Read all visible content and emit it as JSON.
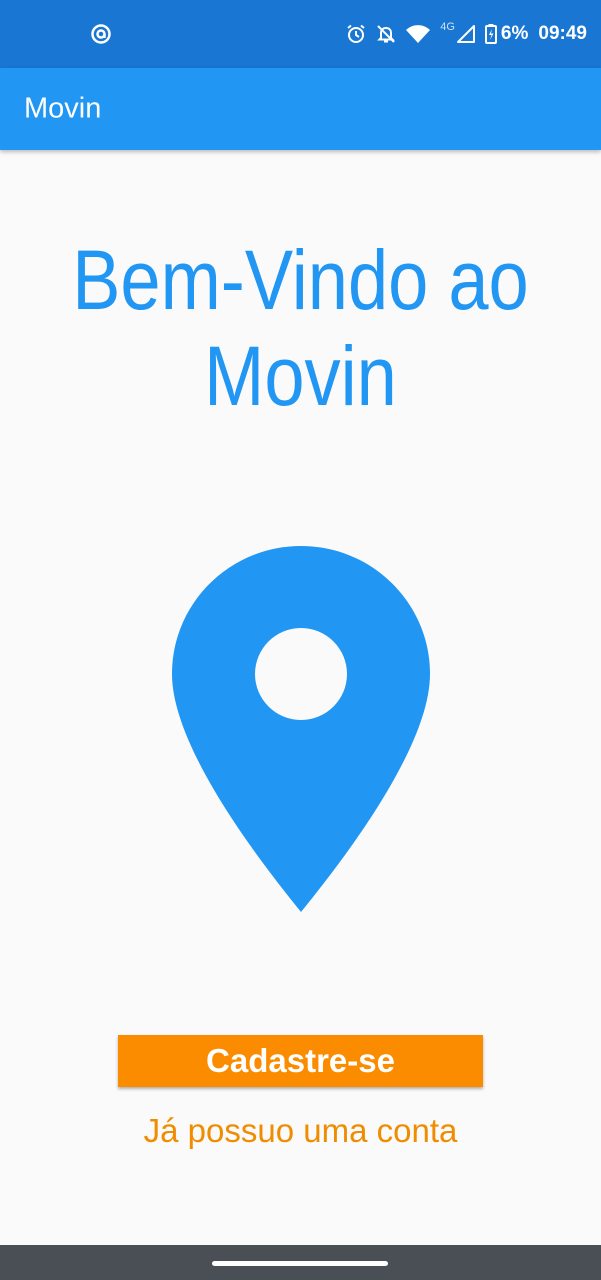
{
  "status_bar": {
    "left_icon": "at-sign-icon",
    "icons": [
      "alarm-icon",
      "notifications-off-icon",
      "wifi-icon",
      "cell-signal-icon",
      "battery-charging-icon"
    ],
    "network_label": "4G",
    "battery": "6%",
    "time": "09:49",
    "background": "#1976d2"
  },
  "app_bar": {
    "title": "Movin",
    "background": "#2196f3"
  },
  "main": {
    "welcome_line1": "Bem-Vindo ao",
    "welcome_line2": "Movin",
    "welcome_color": "#2196f3",
    "pin_icon": "location-pin-icon",
    "pin_color": "#2196f3"
  },
  "actions": {
    "signup_label": "Cadastre-se",
    "signup_color": "#fb8c00",
    "login_label": "Já possuo uma conta",
    "login_color": "#f08c00"
  },
  "nav_bar": {
    "handle": "home-gesture-handle"
  }
}
